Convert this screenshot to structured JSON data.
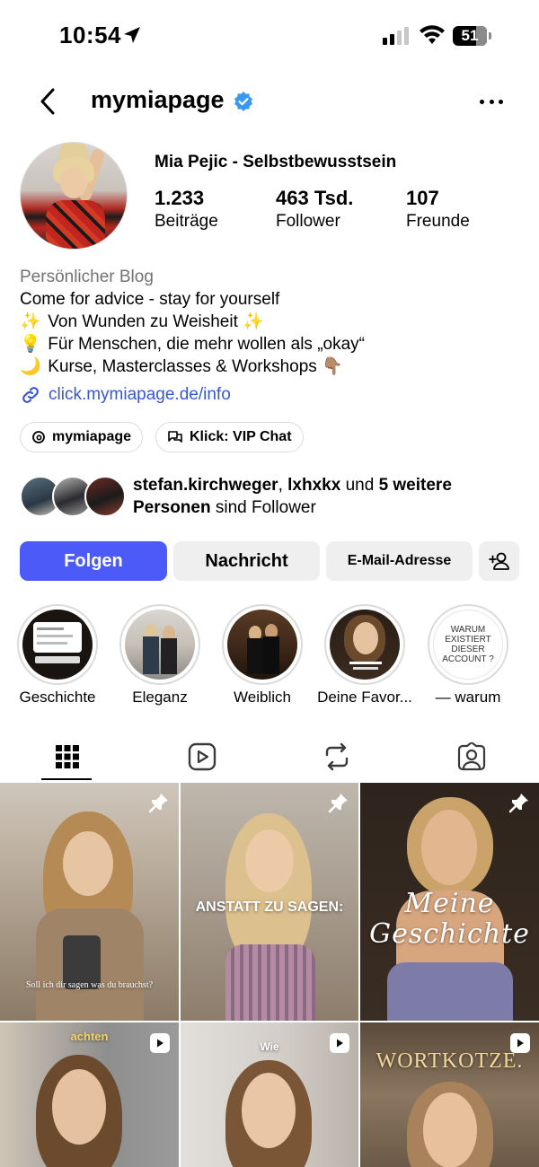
{
  "status_bar": {
    "time": "10:54",
    "battery": "51"
  },
  "header": {
    "username": "mymiapage"
  },
  "profile": {
    "display_name": "Mia Pejic - Selbstbewusstsein",
    "stats": [
      {
        "value": "1.233",
        "label": "Beiträge"
      },
      {
        "value": "463 Tsd.",
        "label": "Follower"
      },
      {
        "value": "107",
        "label": "Freunde"
      }
    ],
    "category": "Persönlicher Blog",
    "bio_lines": [
      {
        "emoji": "✨",
        "text": "Come for advice - stay for yourself"
      },
      {
        "emoji": "✨",
        "text": "Von Wunden zu Weisheit ✨"
      },
      {
        "emoji": "💡",
        "text": "Für Menschen, die mehr wollen als „okay“"
      },
      {
        "emoji": "🌙",
        "text": "Kurse, Masterclasses & Workshops 👇🏽"
      }
    ],
    "link": "click.mymiapage.de/info"
  },
  "pills": [
    {
      "label": "mymiapage",
      "icon": "threads-icon"
    },
    {
      "label": "Klick: VIP Chat",
      "icon": "chat-bubbles-icon"
    }
  ],
  "followed_by": {
    "user1": "stefan.kirchweger",
    "sep": ", ",
    "user2": "lxhxkx",
    "and": " und ",
    "more": "5 weitere Personen",
    "suffix": " sind Follower"
  },
  "buttons": {
    "follow": "Folgen",
    "message": "Nachricht",
    "email": "E-Mail-Adresse"
  },
  "highlights": [
    {
      "label": "Geschichte"
    },
    {
      "label": "Eleganz"
    },
    {
      "label": "Weiblich"
    },
    {
      "label": "Deine Favor..."
    },
    {
      "label": "— warum",
      "cover_text": "WARUM EXISTIERT DIESER ACCOUNT ?"
    }
  ],
  "tabs": [
    {
      "name": "grid-icon",
      "active": true
    },
    {
      "name": "reels-icon",
      "active": false
    },
    {
      "name": "reposts-icon",
      "active": false
    },
    {
      "name": "tagged-icon",
      "active": false
    }
  ],
  "posts": [
    {
      "caption": "Soll ich dir sagen was du brauchst?",
      "pinned": true
    },
    {
      "caption": "ANSTATT ZU SAGEN:",
      "pinned": true
    },
    {
      "caption": "Meine Geschichte",
      "pinned": true
    },
    {
      "caption": "achten",
      "reel": true
    },
    {
      "caption": "Wie",
      "reel": true
    },
    {
      "caption": "WORTKOTZE.",
      "reel": true
    }
  ],
  "colors": {
    "accent": "#4c5bf7",
    "link": "#3758d4",
    "muted": "#737373",
    "verified": "#3897f0"
  }
}
